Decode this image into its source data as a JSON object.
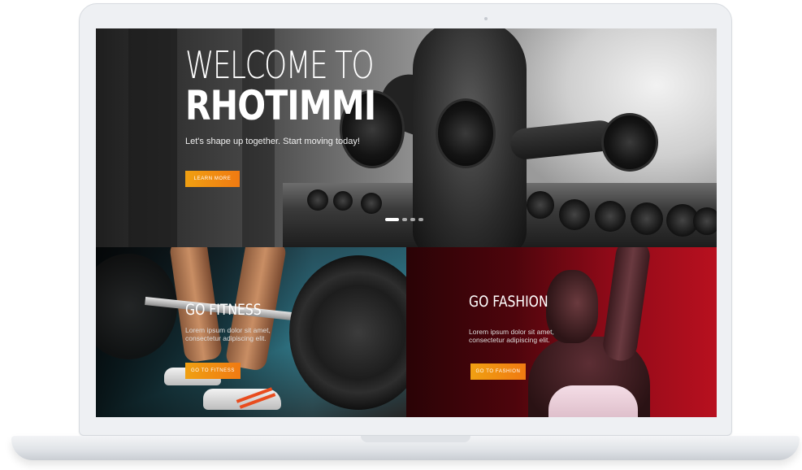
{
  "hero": {
    "title_line1": "WELCOME TO",
    "title_line2": "RHOTIMMI",
    "tagline": "Let's shape up together. Start moving today!",
    "button_label": "LEARN MORE",
    "slides": {
      "total": 4,
      "active": 1
    }
  },
  "cards": [
    {
      "title": "GO FITNESS",
      "body": "Lorem ipsum dolor sit amet, consectetur adipiscing elit.",
      "button_label": "GO TO FITNESS"
    },
    {
      "title": "GO FASHION",
      "body": "Lorem ipsum dolor sit amet, consectetur adipiscing elit.",
      "button_label": "GO TO FASHION"
    }
  ],
  "colors": {
    "accent_start": "#f0a012",
    "accent_end": "#f07a12",
    "fashion_red": "#b8101f",
    "laptop_silver": "#eef0f3"
  },
  "icons": [
    "camera-icon"
  ]
}
